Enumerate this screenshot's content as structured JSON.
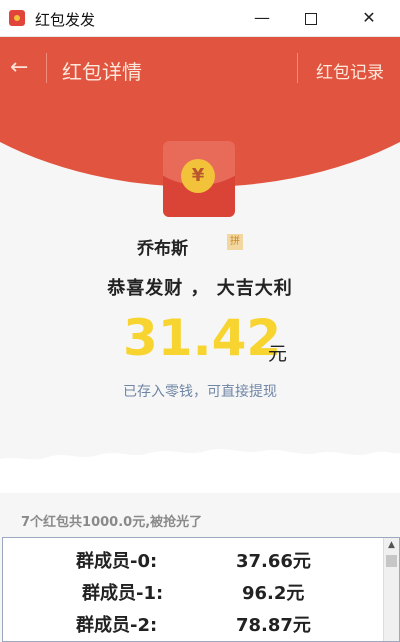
{
  "window": {
    "title": "红包发发",
    "minimize_icon": "minimize-icon",
    "maximize_icon": "maximize-icon",
    "close_icon": "close-icon"
  },
  "header": {
    "back_label": "←",
    "title": "红包详情",
    "record_label": "红包记录"
  },
  "envelope": {
    "coin_symbol": "¥"
  },
  "sender": {
    "name": "乔布斯",
    "badge": "拼"
  },
  "wish": "恭喜发财 ， 大吉大利",
  "received": {
    "amount": "31.42",
    "unit": "元",
    "note": "已存入零钱，可直接提现"
  },
  "summary": "7个红包共1000.0元,被抢光了",
  "members": [
    {
      "name": "群成员-0:",
      "amount": "37.66元"
    },
    {
      "name": "群成员-1:",
      "amount": "96.2元"
    },
    {
      "name": "群成员-2:",
      "amount": "78.87元"
    }
  ],
  "scroll_up": "▲",
  "colors": {
    "header_red": "#e1543f",
    "amount_yellow": "#f7d42f",
    "link_blue": "#6f86a6"
  }
}
